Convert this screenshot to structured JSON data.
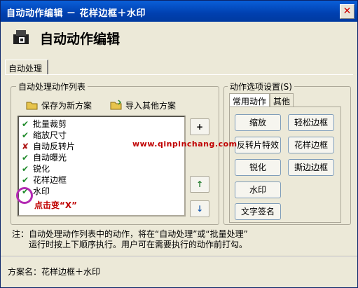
{
  "window": {
    "title": "自动动作编辑 － 花样边框＋水印",
    "close": "✕"
  },
  "header": {
    "heading": "自动动作编辑"
  },
  "main_tab": "自动处理",
  "left_group": {
    "label": "自动处理动作列表",
    "save_label": "保存为新方案",
    "import_label": "导入其他方案",
    "items": [
      {
        "mark": "✔",
        "label": "批量裁剪"
      },
      {
        "mark": "✔",
        "label": "缩放尺寸"
      },
      {
        "mark": "✘",
        "label": "自动反转片"
      },
      {
        "mark": "✔",
        "label": "自动曝光"
      },
      {
        "mark": "✔",
        "label": "锐化"
      },
      {
        "mark": "✔",
        "label": "花样边框"
      },
      {
        "mark": "✔",
        "label": "水印"
      }
    ],
    "add": "+",
    "up": "↑",
    "down": "↓"
  },
  "right_group": {
    "label": "动作选项设置(S)",
    "tabs": [
      "常用动作",
      "其他"
    ],
    "buttons": [
      "缩放",
      "轻松边框",
      "反转片特效",
      "花样边框",
      "锐化",
      "撕边边框",
      "水印",
      "文字签名"
    ]
  },
  "note": {
    "line1": "注：自动处理动作列表中的动作，将在“自动处理”或“批量处理”",
    "line2": "运行时按上下顺序执行。用户可在需要执行的动作前打勾。"
  },
  "scheme": "方案名：花样边框＋水印",
  "annotations": {
    "watermark": "www.qinpinchang.com",
    "click_text": "点击变“X”"
  },
  "colors": {
    "titlebar": "#0a5fd8",
    "check": "#1f8a2a",
    "cross": "#b01a1a",
    "annotation": "#c00000",
    "circle": "#b32ab3"
  }
}
